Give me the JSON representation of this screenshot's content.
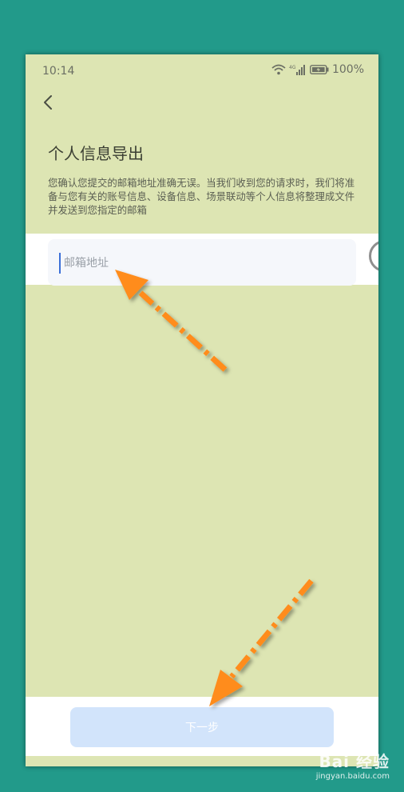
{
  "status_bar": {
    "time": "10:14",
    "battery_pct": "100%",
    "icons": [
      "wifi-icon",
      "signal-icon",
      "battery-icon"
    ]
  },
  "header": {
    "back_icon": "chevron-left-icon"
  },
  "page": {
    "title": "个人信息导出",
    "description": "您确认您提交的邮箱地址准确无误。当我们收到您的请求时，我们将准备与您有关的账号信息、设备信息、场景联动等个人信息将整理成文件并发送到您指定的邮箱"
  },
  "form": {
    "email_placeholder": "邮箱地址",
    "email_value": ""
  },
  "footer": {
    "next_label": "下一步"
  },
  "watermark": {
    "logo": "Bai 经验",
    "url": "jingyan.baidu.com"
  },
  "colors": {
    "background": "#229a8a",
    "frame": "#dde5b3",
    "button": "#d2e4fb",
    "arrow": "#ff8c1a"
  }
}
